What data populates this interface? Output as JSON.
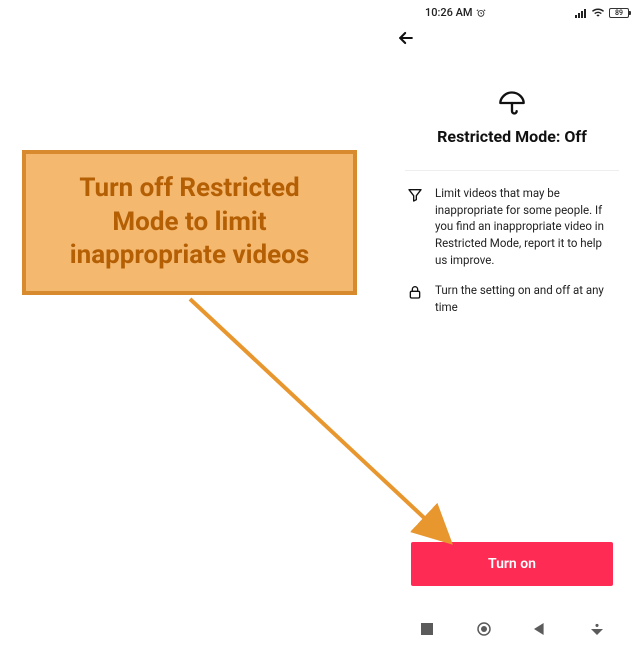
{
  "statusbar": {
    "time": "10:26 AM",
    "battery_text": "89"
  },
  "page": {
    "title": "Restricted Mode: Off"
  },
  "features": {
    "limit": "Limit videos that may be inappropriate for some people. If you find an inappropriate video in Restricted Mode, report it to help us improve.",
    "toggle": "Turn the setting on and off at any time"
  },
  "cta_label": "Turn on",
  "callout": "Turn off Restricted Mode to limit inappropriate videos"
}
